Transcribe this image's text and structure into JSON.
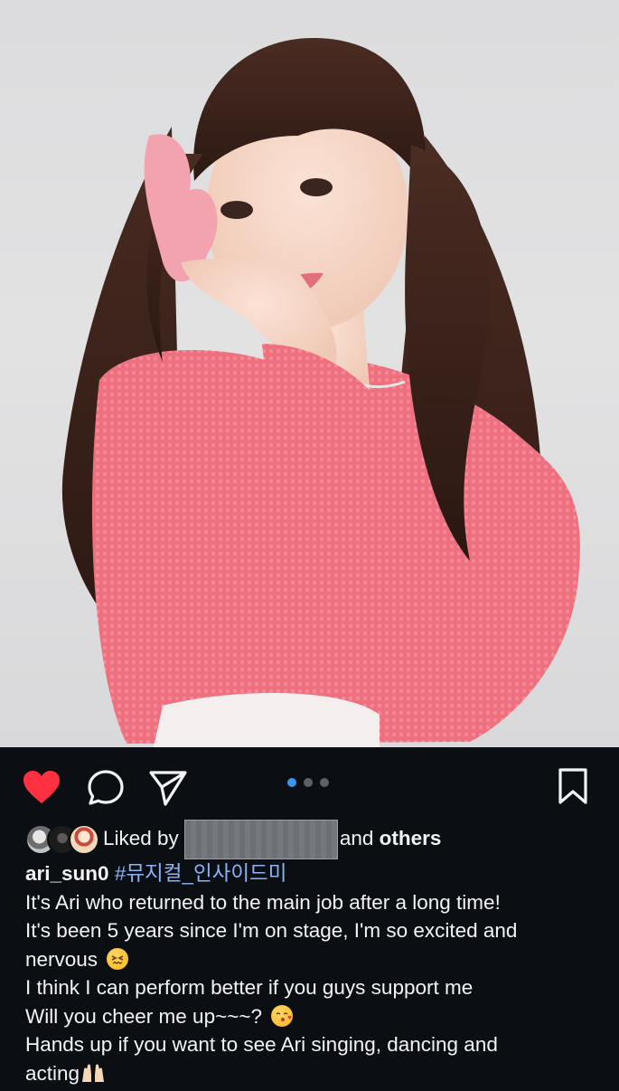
{
  "post": {
    "liked_prefix": "Liked by",
    "liked_suffix_and": "and",
    "liked_suffix_others": "others",
    "username": "ari_sun0",
    "hashtag": "#뮤지컬_인사이드미",
    "caption_lines": [
      "It's Ari who returned to the main job after a long time!",
      "It's been 5 years since I'm on stage, I'm so excited and",
      "nervous",
      "I think I can perform better if you guys support me",
      "Will you cheer me up~~~?",
      "Hands up if you want to see Ari singing, dancing and",
      "acting"
    ]
  },
  "carousel": {
    "total": 3,
    "active_index": 0
  },
  "colors": {
    "background": "#0b0f14",
    "like_red": "#ff3040",
    "hashtag_blue": "#8cb4f5",
    "active_dot": "#3897f0"
  },
  "icons": [
    "heart-icon",
    "comment-icon",
    "share-icon",
    "bookmark-icon"
  ]
}
